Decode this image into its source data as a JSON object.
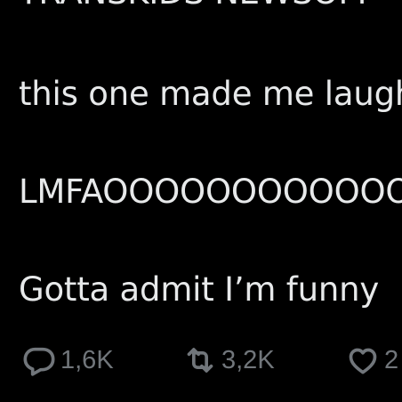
{
  "post": {
    "text_cut_top": "TRANSKIDS NEWSOM",
    "lines": [
      "this one made me laugh",
      "LMFAOOOOOOOOOOOOOOO",
      "Gotta admit I’m funny"
    ]
  },
  "actions": {
    "reply": {
      "icon": "reply-icon",
      "count": "1,6K"
    },
    "repost": {
      "icon": "repost-icon",
      "count": "3,2K"
    },
    "like": {
      "icon": "heart-icon",
      "count": "2"
    }
  },
  "colors": {
    "background": "#000000",
    "text": "#e7e9ea",
    "muted": "#71767b"
  }
}
